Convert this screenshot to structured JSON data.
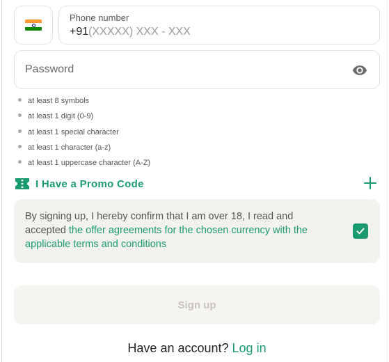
{
  "phone": {
    "label": "Phone number",
    "prefix": "+91",
    "mask": "(XXXXX) XXX - XXX",
    "country_flag": "india-flag-icon"
  },
  "password": {
    "placeholder": "Password",
    "visibility_icon": "eye-icon"
  },
  "password_rules": [
    "at least 8 symbols",
    "at least 1 digit (0-9)",
    "at least 1 special character",
    "at least 1 character (a-z)",
    "at least 1 uppercase character (A-Z)"
  ],
  "promo": {
    "label": "I Have a Promo Code",
    "icon": "ticket-icon",
    "expand_icon": "plus-icon"
  },
  "terms": {
    "text": "By signing up, I hereby confirm that I am over 18, I read and accepted ",
    "link": "the offer agreements for the chosen currency with the applicable terms and conditions",
    "checked": true
  },
  "signup_button": "Sign up",
  "footer": {
    "question": "Have an account? ",
    "login_link": "Log in"
  },
  "colors": {
    "accent": "#1a9a6e",
    "terms_bg": "#f4f2ee",
    "disabled_text": "#c6c3bd"
  }
}
